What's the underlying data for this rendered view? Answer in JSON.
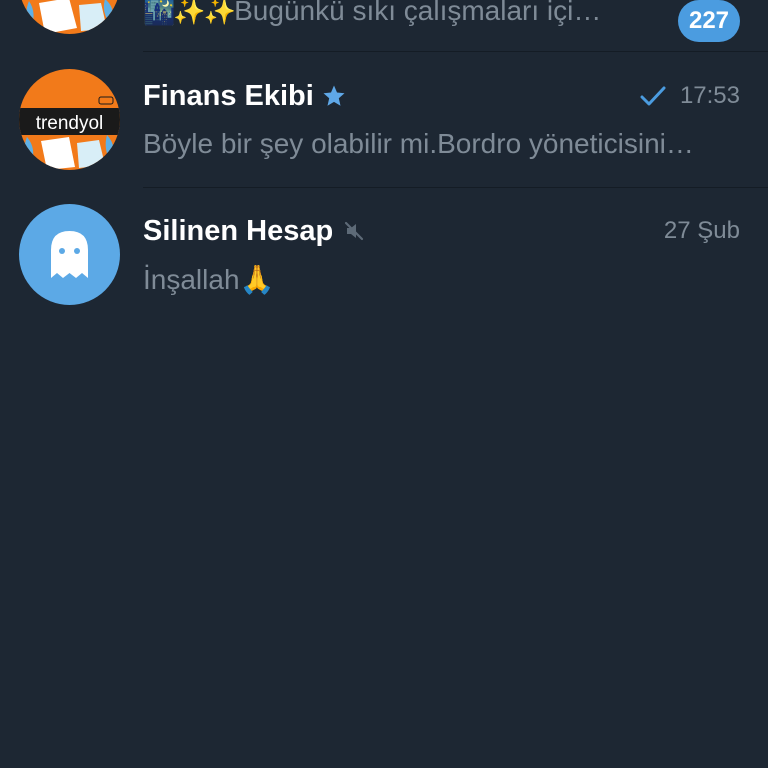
{
  "colors": {
    "background": "#1d2733",
    "accent": "#4b9ce0",
    "muted_text": "#7f8b97",
    "title_text": "#ffffff"
  },
  "chats": [
    {
      "name": "",
      "preview_emoji": "🌃✨✨",
      "preview": "Bugünkü sıkı çalışmaları içi…",
      "unread_count": "227",
      "avatar": "trendyol-logo"
    },
    {
      "name": "Finans Ekibi",
      "badge_icon": "star-icon",
      "status_icon": "check-icon",
      "time": "17:53",
      "preview": "Böyle bir şey olabilir mi.Bordro yöneticisini…",
      "avatar": "trendyol-logo",
      "avatar_text": "trendyol"
    },
    {
      "name": "Silinen Hesap",
      "badge_icon": "muted-icon",
      "time": "27 Şub",
      "preview": "İnşallah🙏",
      "avatar": "ghost-icon"
    }
  ]
}
